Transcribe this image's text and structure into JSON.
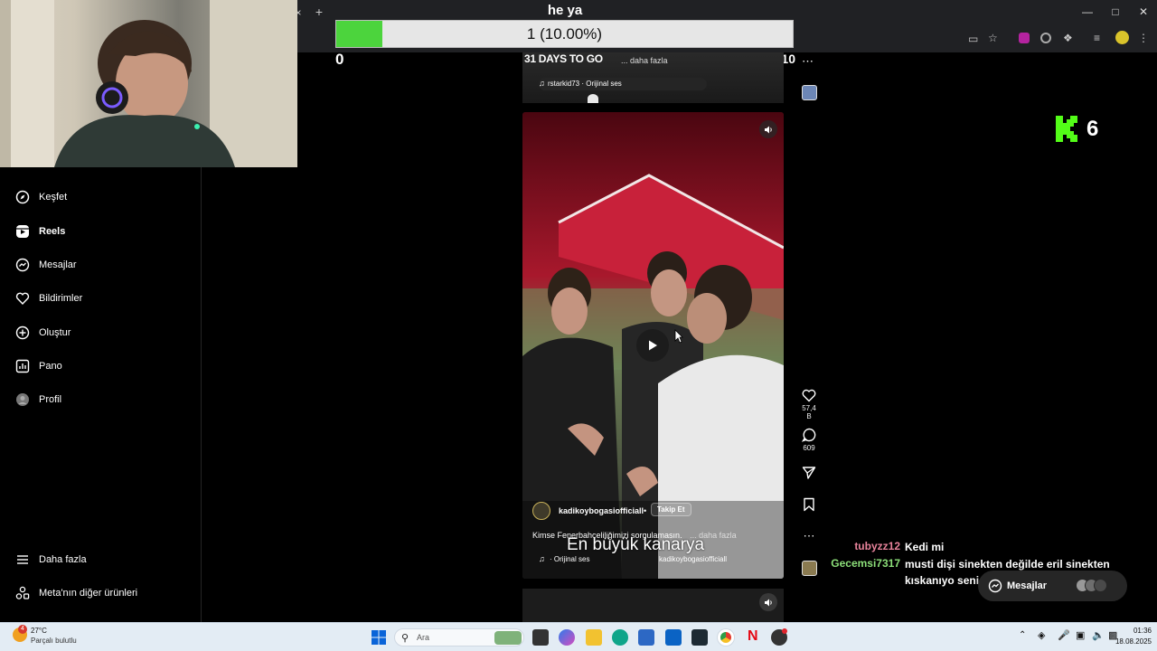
{
  "poll": {
    "title": "he ya",
    "result_text": "1 (10.00%)",
    "fraction": 0.1,
    "left_count": "0",
    "right_count": "10",
    "countdown": "31 DAYS TO GO"
  },
  "overlay": {
    "badge_count": "6"
  },
  "browser": {
    "close_tab_glyph": "×",
    "new_tab_glyph": "+"
  },
  "sidebar": {
    "items": [
      {
        "label": "Keşfet",
        "icon": "compass-icon"
      },
      {
        "label": "Reels",
        "icon": "reels-icon"
      },
      {
        "label": "Mesajlar",
        "icon": "messenger-icon"
      },
      {
        "label": "Bildirimler",
        "icon": "heart-icon"
      },
      {
        "label": "Oluştur",
        "icon": "plus-square-icon"
      },
      {
        "label": "Pano",
        "icon": "dashboard-icon"
      },
      {
        "label": "Profil",
        "icon": "avatar-icon"
      }
    ],
    "more_label": "Daha fazla",
    "meta_label": "Meta'nın diğer ürünleri"
  },
  "prev_reel": {
    "caption_more": "... daha fazla",
    "audio": "rstarkid73 · Orijinal ses"
  },
  "reel": {
    "username": "kadikoybogasiofficiall",
    "follow_label": "Takip Et",
    "separator": "•",
    "caption": "Kimse Fenerbahçeliliğimizi sorgulamasın.",
    "caption_more": "... daha fazla",
    "subtitle": "En büyük kanarya",
    "audio": "· Orijinal ses",
    "audio_user": "kadikoybogasiofficiall"
  },
  "actions": {
    "likes": "57,4 B",
    "comments": "609"
  },
  "chat": [
    {
      "user": "tubyzz12",
      "color": "#e8839b",
      "message": "Kedi mi"
    },
    {
      "user": "Gecemsi7317",
      "color": "#8de07a",
      "message": "musti dişi sinekten değilde eril sinekten kıskanıyo seni"
    }
  ],
  "messages_pill": {
    "label": "Mesajlar"
  },
  "taskbar": {
    "temperature": "27°C",
    "weather": "Parçalı bulutlu",
    "weather_badge": "4",
    "search_placeholder": "Ara",
    "time": "01:36",
    "date": "18.08.2025"
  }
}
